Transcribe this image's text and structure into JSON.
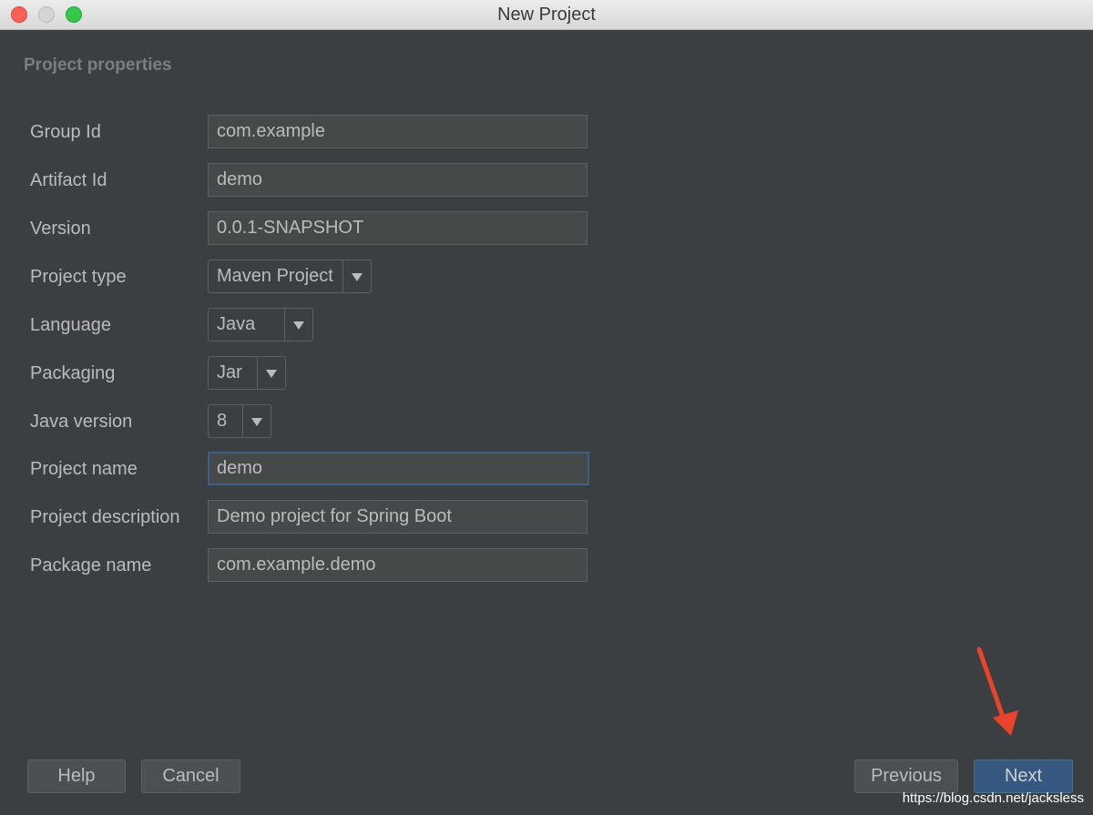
{
  "window": {
    "title": "New Project"
  },
  "section": {
    "title": "Project properties"
  },
  "fields": {
    "group_id": {
      "label": "Group Id",
      "value": "com.example"
    },
    "artifact_id": {
      "label": "Artifact Id",
      "value": "demo"
    },
    "version": {
      "label": "Version",
      "value": "0.0.1-SNAPSHOT"
    },
    "project_type": {
      "label": "Project type",
      "value": "Maven Project"
    },
    "language": {
      "label": "Language",
      "value": "Java"
    },
    "packaging": {
      "label": "Packaging",
      "value": "Jar"
    },
    "java_version": {
      "label": "Java version",
      "value": "8"
    },
    "project_name": {
      "label": "Project name",
      "value": "demo"
    },
    "project_description": {
      "label": "Project description",
      "value": "Demo project for Spring Boot"
    },
    "package_name": {
      "label": "Package name",
      "value": "com.example.demo"
    }
  },
  "buttons": {
    "help": "Help",
    "cancel": "Cancel",
    "previous": "Previous",
    "next": "Next"
  },
  "watermark": "https://blog.csdn.net/jacksless",
  "colors": {
    "background": "#3c3f41",
    "primary_button": "#365880",
    "focus_border": "#3d6185",
    "annotation_arrow": "#e8442b"
  },
  "icons": {
    "dropdown": "triangle-down-icon",
    "annotation": "red-arrow-icon"
  }
}
